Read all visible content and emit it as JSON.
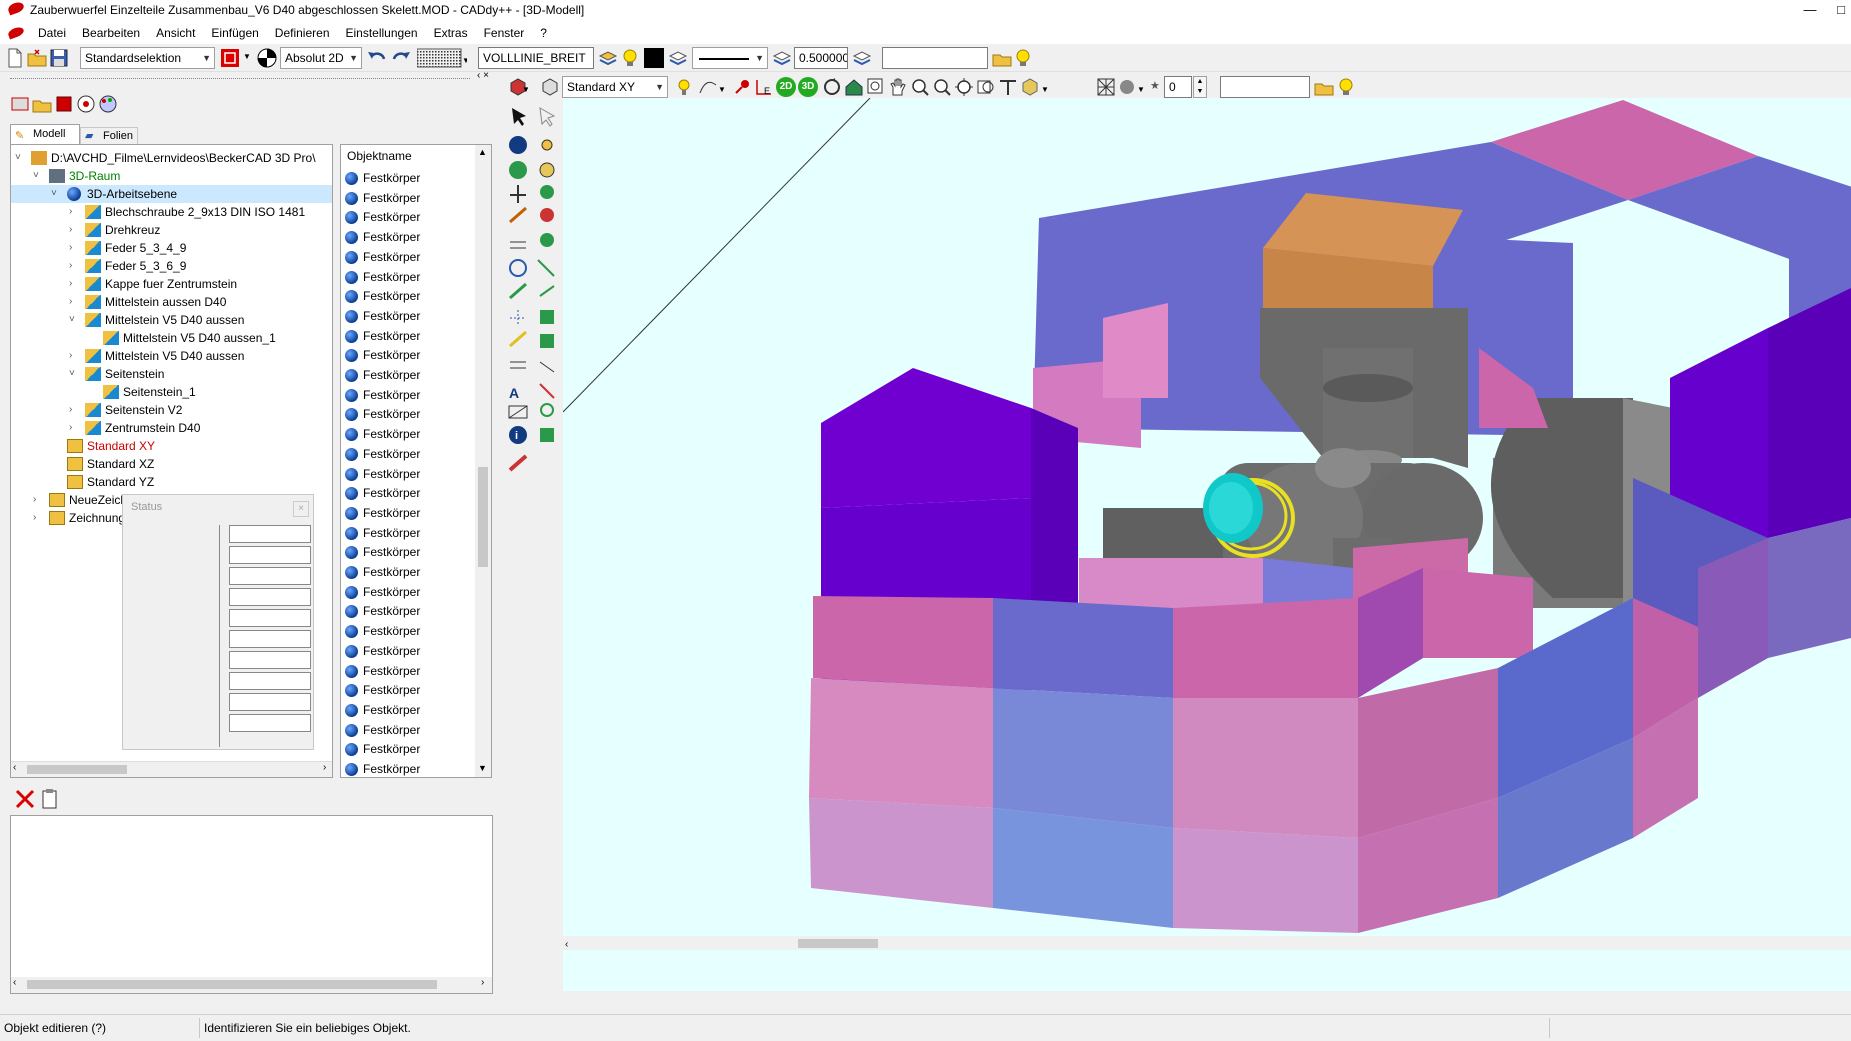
{
  "window": {
    "title": "Zauberwuerfel Einzelteile Zusammenbau_V6 D40 abgeschlossen Skelett.MOD - CADdy++ - [3D-Modell]",
    "minimize": "—",
    "maximize": "□"
  },
  "menu": [
    "Datei",
    "Bearbeiten",
    "Ansicht",
    "Einfügen",
    "Definieren",
    "Einstellungen",
    "Extras",
    "Fenster",
    "?"
  ],
  "toolbar1": {
    "selection_mode": "Standardselektion",
    "coord_mode": "Absolut 2D",
    "linetype": "VOLLLINIE_BREIT",
    "line_width": "0.500000",
    "empty_field": ""
  },
  "toolbar2": {
    "view_plane": "Standard XY",
    "view_2d": "2D",
    "view_3d": "3D",
    "spin_value": "0",
    "empty_field": ""
  },
  "tabs": [
    "Modell",
    "Folien"
  ],
  "tree": [
    {
      "label": "D:\\AVCHD_Filme\\Lernvideos\\BeckerCAD 3D Pro\\",
      "level": 1,
      "expander": "˅",
      "color": "#000000"
    },
    {
      "label": "3D-Raum",
      "level": 2,
      "expander": "˅",
      "color": "#008000"
    },
    {
      "label": "3D-Arbeitsebene",
      "level": 3,
      "expander": "˅",
      "color": "#000000",
      "selected": true
    },
    {
      "label": "Blechschraube 2_9x13 DIN ISO 1481",
      "level": 4,
      "expander": "›",
      "color": "#000000"
    },
    {
      "label": "Drehkreuz",
      "level": 4,
      "expander": "›",
      "color": "#000000"
    },
    {
      "label": "Feder 5_3_4_9",
      "level": 4,
      "expander": "›",
      "color": "#000000"
    },
    {
      "label": "Feder 5_3_6_9",
      "level": 4,
      "expander": "›",
      "color": "#000000"
    },
    {
      "label": "Kappe fuer Zentrumstein",
      "level": 4,
      "expander": "›",
      "color": "#000000"
    },
    {
      "label": "Mittelstein aussen D40",
      "level": 4,
      "expander": "›",
      "color": "#000000"
    },
    {
      "label": "Mittelstein V5 D40 aussen",
      "level": 4,
      "expander": "˅",
      "color": "#000000"
    },
    {
      "label": "Mittelstein V5 D40 aussen_1",
      "level": 5,
      "expander": "",
      "color": "#000000"
    },
    {
      "label": "Mittelstein V5 D40 aussen",
      "level": 4,
      "expander": "›",
      "color": "#000000"
    },
    {
      "label": "Seitenstein",
      "level": 4,
      "expander": "˅",
      "color": "#000000"
    },
    {
      "label": "Seitenstein_1",
      "level": 5,
      "expander": "",
      "color": "#000000"
    },
    {
      "label": "Seitenstein V2",
      "level": 4,
      "expander": "›",
      "color": "#000000"
    },
    {
      "label": "Zentrumstein D40",
      "level": 4,
      "expander": "›",
      "color": "#000000"
    },
    {
      "label": "Standard XY",
      "level": 3,
      "expander": "",
      "color": "#cc0000",
      "folder": true
    },
    {
      "label": "Standard XZ",
      "level": 3,
      "expander": "",
      "color": "#000000",
      "folder": true
    },
    {
      "label": "Standard YZ",
      "level": 3,
      "expander": "",
      "color": "#000000",
      "folder": true
    },
    {
      "label": "NeueZeichnung",
      "level": 2,
      "expander": "›",
      "color": "#000000",
      "folder": true
    },
    {
      "label": "Zeichnung",
      "level": 2,
      "expander": "›",
      "color": "#000000",
      "folder": true
    }
  ],
  "object_list": {
    "header": "Objektname",
    "items": [
      "Festkörper",
      "Festkörper",
      "Festkörper",
      "Festkörper",
      "Festkörper",
      "Festkörper",
      "Festkörper",
      "Festkörper",
      "Festkörper",
      "Festkörper",
      "Festkörper",
      "Festkörper",
      "Festkörper",
      "Festkörper",
      "Festkörper",
      "Festkörper",
      "Festkörper",
      "Festkörper",
      "Festkörper",
      "Festkörper",
      "Festkörper",
      "Festkörper",
      "Festkörper",
      "Festkörper",
      "Festkörper",
      "Festkörper",
      "Festkörper",
      "Festkörper",
      "Festkörper",
      "Festkörper",
      "Festkörper",
      "Festkörper"
    ]
  },
  "status_window": {
    "title": "Status",
    "close": "×"
  },
  "statusbar": {
    "left": "Objekt editieren (?)",
    "middle": "Identifizieren Sie ein beliebiges Objekt.",
    "right": ""
  },
  "colors": {
    "pink": "#cc66aa",
    "blue": "#6666cc",
    "violet": "#6600cc",
    "gray": "#6e6e6e",
    "viewport_bg": "#e6ffff",
    "cyan": "#11c8c8",
    "yellow": "#e8e020",
    "orange": "#e88a20"
  }
}
